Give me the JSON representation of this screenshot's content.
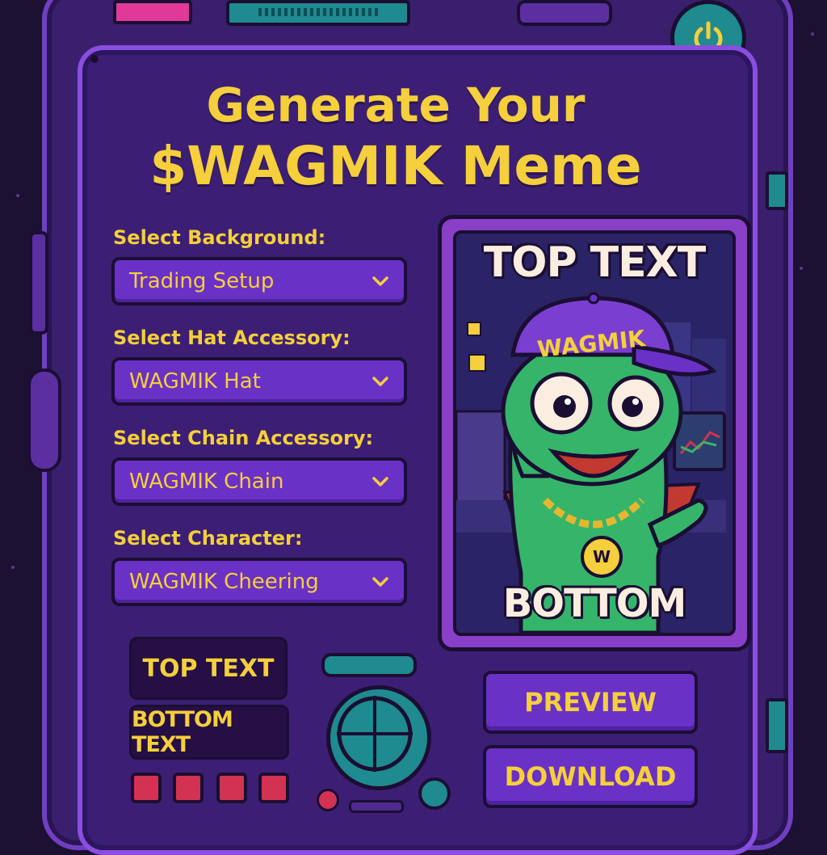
{
  "title": {
    "line1": "Generate Your",
    "line2": "$WAGMIK Meme"
  },
  "form": {
    "fields": [
      {
        "label": "Select Background:",
        "value": "Trading Setup"
      },
      {
        "label": "Select Hat Accessory:",
        "value": "WAGMIK Hat"
      },
      {
        "label": "Select Chain Accessory:",
        "value": "WAGMIK Chain"
      },
      {
        "label": "Select Character:",
        "value": "WAGMIK Cheering"
      }
    ],
    "top_text_input": "TOP TEXT",
    "bottom_text_input": "BOTTOM TEXT"
  },
  "preview": {
    "top_text": "TOP TEXT",
    "bottom_text": "BOTTOM TEXT",
    "hat_text": "WAGMIK",
    "medallion_text": "W"
  },
  "actions": {
    "preview_label": "PREVIEW",
    "download_label": "DOWNLOAD"
  },
  "icons": {
    "power": "power-icon",
    "dropdown": "chevron-down-icon",
    "dial": "crosshair-dial-icon"
  },
  "colors": {
    "accent_yellow": "#f5cf3c",
    "panel_purple": "#3c1f74",
    "button_purple": "#6a31c6",
    "teal": "#1f8a8f",
    "red": "#d23352",
    "frog_green": "#35b56a"
  }
}
